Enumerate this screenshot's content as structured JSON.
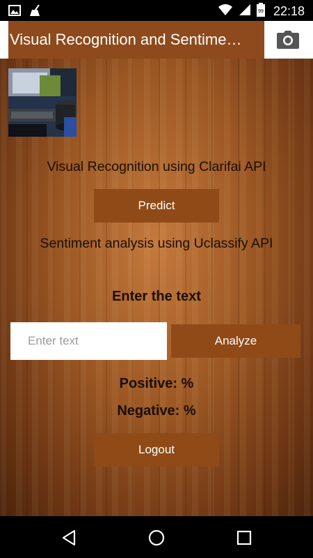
{
  "status_bar": {
    "time": "22:18",
    "left_icons": [
      "image-icon",
      "broom-icon"
    ],
    "right_icons": [
      "wifi-icon",
      "cellular-icon",
      "battery-icon"
    ],
    "battery_level": "99"
  },
  "app_bar": {
    "title": "Visual Recognition and Sentime…",
    "action_icon": "camera-icon"
  },
  "main": {
    "visual_heading": "Visual Recognition using Clarifai API",
    "predict_label": "Predict",
    "sentiment_heading": "Sentiment analysis using Uclassify API",
    "enter_text_label": "Enter the text",
    "text_input": {
      "value": "",
      "placeholder": "Enter text"
    },
    "analyze_label": "Analyze",
    "positive_label": "Positive: %",
    "negative_label": "Negative: %",
    "logout_label": "Logout"
  },
  "nav_bar": {
    "icons": [
      "back-icon",
      "home-icon",
      "recents-icon"
    ]
  },
  "colors": {
    "accent": "#8e4a1c",
    "button": "#8f4a17",
    "text_dark": "#1a0e05"
  }
}
